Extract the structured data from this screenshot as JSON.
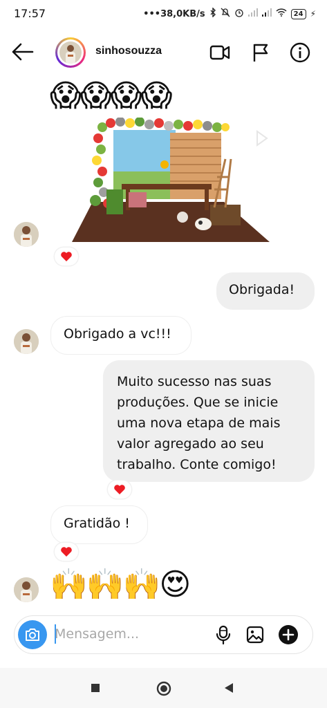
{
  "status_bar": {
    "time": "17:57",
    "network_speed": "•••38,0KB/s",
    "battery": "24"
  },
  "header": {
    "username": "sinhosouzza"
  },
  "messages": {
    "emoji_row_top": "😱😱😱😱",
    "outgoing_1": "Obrigada!",
    "incoming_1": "Obrigado a vc!!!",
    "outgoing_2": "Muito sucesso nas suas produções. Que se inicie uma nova etapa de mais valor agregado ao seu trabalho. Conte comigo!",
    "incoming_2": "Gratidão !",
    "emoji_row_bottom": "🙌🙌🙌😍"
  },
  "composer": {
    "placeholder": "Mensagem..."
  },
  "colors": {
    "accent_blue": "#3897f0",
    "heart_red": "#ed1c24",
    "outgoing_bubble": "#efefef"
  }
}
